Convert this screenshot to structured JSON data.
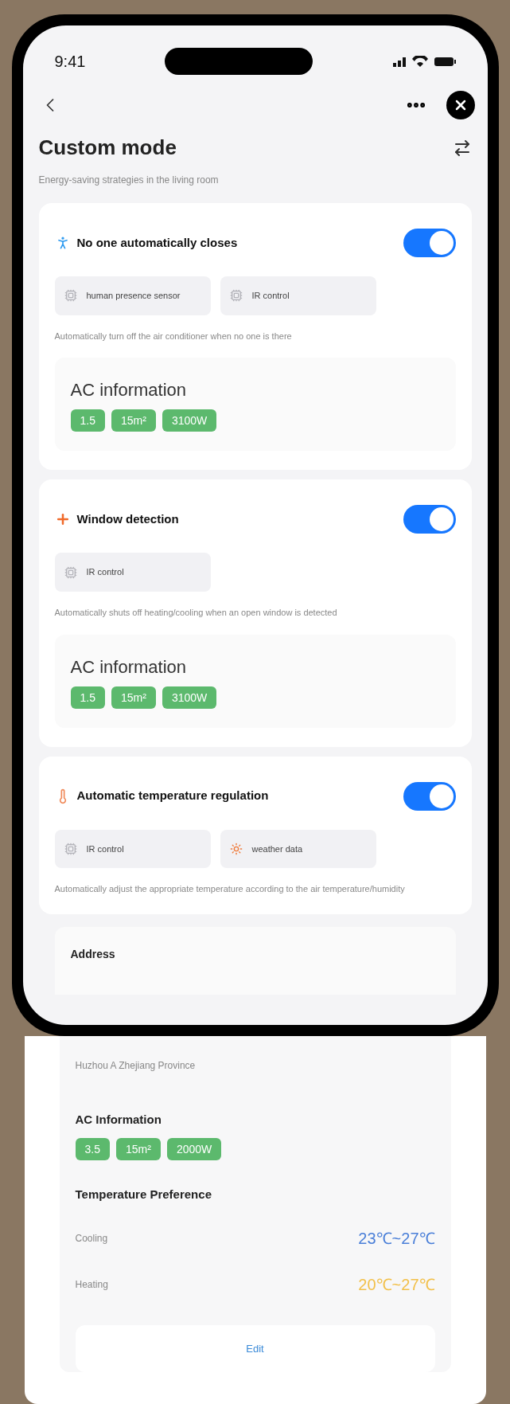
{
  "status_bar": {
    "time": "9:41"
  },
  "header": {
    "title": "Custom mode",
    "subtitle": "Energy-saving strategies in the living room"
  },
  "sections": [
    {
      "kind": "presence",
      "title": "No one automatically closes",
      "on": true,
      "chips": [
        {
          "kind": "device",
          "label": "human presence sensor"
        },
        {
          "kind": "device",
          "label": "IR control"
        }
      ],
      "description": "Automatically turn off the air conditioner when no one is there",
      "ac": {
        "title": "AC information",
        "tags": [
          "1.5",
          "15m²",
          "3100W"
        ]
      }
    },
    {
      "kind": "window",
      "title": "Window detection",
      "on": true,
      "chips": [
        {
          "kind": "device",
          "label": "IR control"
        }
      ],
      "description": "Automatically shuts off heating/cooling when an open window is detected",
      "ac": {
        "title": "AC information",
        "tags": [
          "1.5",
          "15m²",
          "3100W"
        ]
      }
    },
    {
      "kind": "temperature",
      "title": "Automatic temperature regulation",
      "on": true,
      "chips": [
        {
          "kind": "device",
          "label": "IR control"
        },
        {
          "kind": "weather",
          "label": "weather data"
        }
      ],
      "description": "Automatically adjust the appropriate temperature according to the air temperature/humidity"
    }
  ],
  "detail": {
    "address_label": "Address",
    "address": "Huzhou A Zhejiang Province",
    "ac_title": "AC Information",
    "tags": [
      "3.5",
      "15m²",
      "2000W"
    ],
    "preference_title": "Temperature Preference",
    "preferences": [
      {
        "kind": "cooling",
        "label": "Cooling",
        "range": "23℃~27℃"
      },
      {
        "kind": "heating",
        "label": "Heating",
        "range": "20℃~27℃"
      }
    ],
    "edit_button": "Edit"
  }
}
